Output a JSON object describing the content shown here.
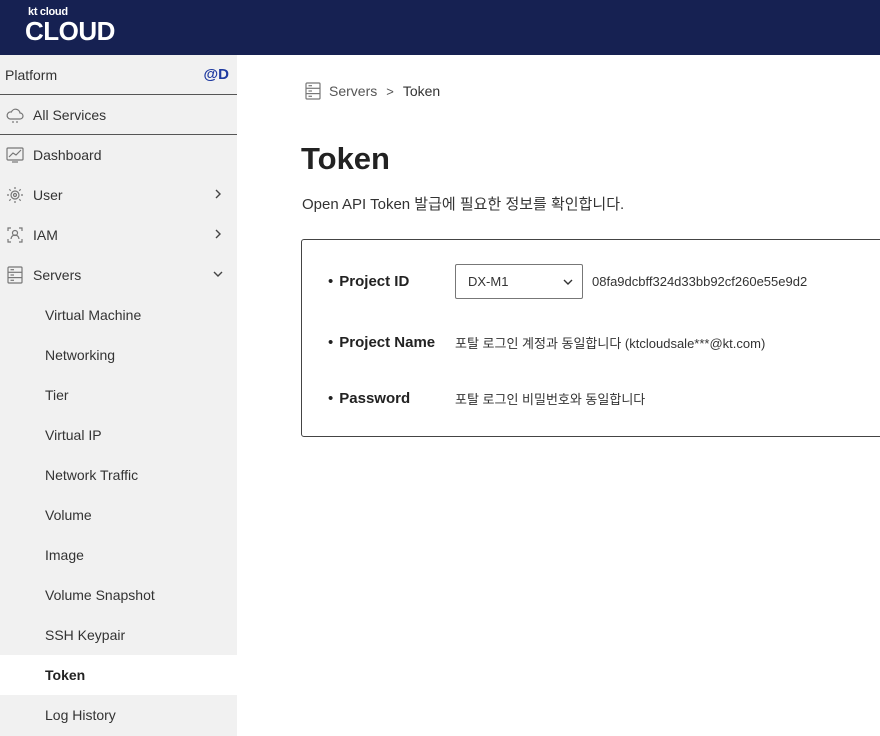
{
  "header": {
    "logo_small": "kt cloud",
    "logo_big": "CLOUD"
  },
  "sidebar": {
    "platform_label": "Platform",
    "platform_user": "@D",
    "all_services": "All Services",
    "items": [
      {
        "label": "Dashboard",
        "icon": "dashboard-icon"
      },
      {
        "label": "User",
        "icon": "user-gear-icon"
      },
      {
        "label": "IAM",
        "icon": "iam-icon"
      },
      {
        "label": "Servers",
        "icon": "server-icon"
      }
    ],
    "servers_sub": [
      "Virtual Machine",
      "Networking",
      "Tier",
      "Virtual IP",
      "Network Traffic",
      "Volume",
      "Image",
      "Volume Snapshot",
      "SSH Keypair",
      "Token",
      "Log History"
    ],
    "active_item": "Token"
  },
  "breadcrumb": {
    "parent": "Servers",
    "separator": ">",
    "current": "Token"
  },
  "page": {
    "title": "Token",
    "description": "Open API Token 발급에 필요한 정보를 확인합니다."
  },
  "token_info": {
    "project_id_label": "Project ID",
    "project_select_value": "DX-M1",
    "project_id_value": "08fa9dcbff324d33bb92cf260e55e9d2",
    "project_name_label": "Project Name",
    "project_name_value": "포탈 로그인 계정과 동일합니다 (ktcloudsale***@kt.com)",
    "password_label": "Password",
    "password_value": "포탈 로그인 비밀번호와 동일합니다"
  },
  "colors": {
    "topbar": "#162152",
    "sidebar_bg": "#f1f1f1",
    "accent": "#1f3aa0"
  }
}
